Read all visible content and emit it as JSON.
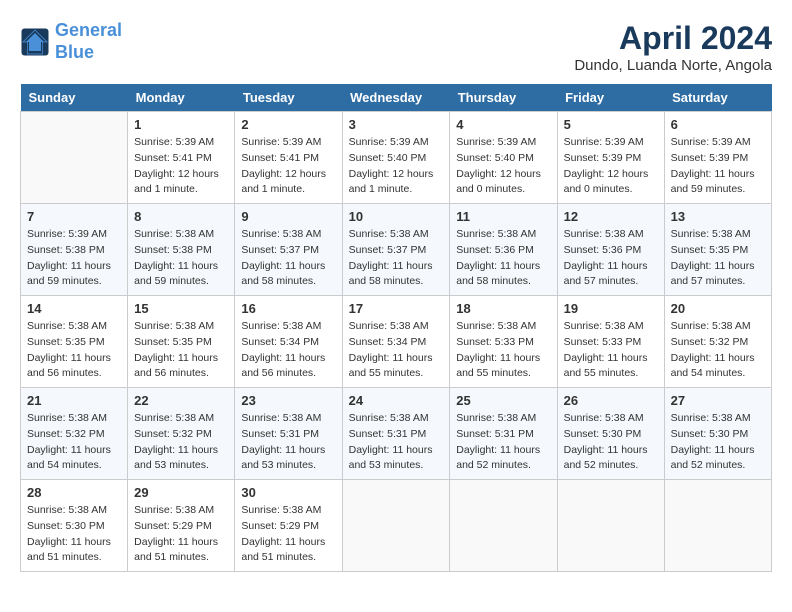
{
  "header": {
    "logo_line1": "General",
    "logo_line2": "Blue",
    "month_year": "April 2024",
    "location": "Dundo, Luanda Norte, Angola"
  },
  "days_of_week": [
    "Sunday",
    "Monday",
    "Tuesday",
    "Wednesday",
    "Thursday",
    "Friday",
    "Saturday"
  ],
  "weeks": [
    [
      {
        "num": "",
        "info": ""
      },
      {
        "num": "1",
        "info": "Sunrise: 5:39 AM\nSunset: 5:41 PM\nDaylight: 12 hours\nand 1 minute."
      },
      {
        "num": "2",
        "info": "Sunrise: 5:39 AM\nSunset: 5:41 PM\nDaylight: 12 hours\nand 1 minute."
      },
      {
        "num": "3",
        "info": "Sunrise: 5:39 AM\nSunset: 5:40 PM\nDaylight: 12 hours\nand 1 minute."
      },
      {
        "num": "4",
        "info": "Sunrise: 5:39 AM\nSunset: 5:40 PM\nDaylight: 12 hours\nand 0 minutes."
      },
      {
        "num": "5",
        "info": "Sunrise: 5:39 AM\nSunset: 5:39 PM\nDaylight: 12 hours\nand 0 minutes."
      },
      {
        "num": "6",
        "info": "Sunrise: 5:39 AM\nSunset: 5:39 PM\nDaylight: 11 hours\nand 59 minutes."
      }
    ],
    [
      {
        "num": "7",
        "info": "Sunrise: 5:39 AM\nSunset: 5:38 PM\nDaylight: 11 hours\nand 59 minutes."
      },
      {
        "num": "8",
        "info": "Sunrise: 5:38 AM\nSunset: 5:38 PM\nDaylight: 11 hours\nand 59 minutes."
      },
      {
        "num": "9",
        "info": "Sunrise: 5:38 AM\nSunset: 5:37 PM\nDaylight: 11 hours\nand 58 minutes."
      },
      {
        "num": "10",
        "info": "Sunrise: 5:38 AM\nSunset: 5:37 PM\nDaylight: 11 hours\nand 58 minutes."
      },
      {
        "num": "11",
        "info": "Sunrise: 5:38 AM\nSunset: 5:36 PM\nDaylight: 11 hours\nand 58 minutes."
      },
      {
        "num": "12",
        "info": "Sunrise: 5:38 AM\nSunset: 5:36 PM\nDaylight: 11 hours\nand 57 minutes."
      },
      {
        "num": "13",
        "info": "Sunrise: 5:38 AM\nSunset: 5:35 PM\nDaylight: 11 hours\nand 57 minutes."
      }
    ],
    [
      {
        "num": "14",
        "info": "Sunrise: 5:38 AM\nSunset: 5:35 PM\nDaylight: 11 hours\nand 56 minutes."
      },
      {
        "num": "15",
        "info": "Sunrise: 5:38 AM\nSunset: 5:35 PM\nDaylight: 11 hours\nand 56 minutes."
      },
      {
        "num": "16",
        "info": "Sunrise: 5:38 AM\nSunset: 5:34 PM\nDaylight: 11 hours\nand 56 minutes."
      },
      {
        "num": "17",
        "info": "Sunrise: 5:38 AM\nSunset: 5:34 PM\nDaylight: 11 hours\nand 55 minutes."
      },
      {
        "num": "18",
        "info": "Sunrise: 5:38 AM\nSunset: 5:33 PM\nDaylight: 11 hours\nand 55 minutes."
      },
      {
        "num": "19",
        "info": "Sunrise: 5:38 AM\nSunset: 5:33 PM\nDaylight: 11 hours\nand 55 minutes."
      },
      {
        "num": "20",
        "info": "Sunrise: 5:38 AM\nSunset: 5:32 PM\nDaylight: 11 hours\nand 54 minutes."
      }
    ],
    [
      {
        "num": "21",
        "info": "Sunrise: 5:38 AM\nSunset: 5:32 PM\nDaylight: 11 hours\nand 54 minutes."
      },
      {
        "num": "22",
        "info": "Sunrise: 5:38 AM\nSunset: 5:32 PM\nDaylight: 11 hours\nand 53 minutes."
      },
      {
        "num": "23",
        "info": "Sunrise: 5:38 AM\nSunset: 5:31 PM\nDaylight: 11 hours\nand 53 minutes."
      },
      {
        "num": "24",
        "info": "Sunrise: 5:38 AM\nSunset: 5:31 PM\nDaylight: 11 hours\nand 53 minutes."
      },
      {
        "num": "25",
        "info": "Sunrise: 5:38 AM\nSunset: 5:31 PM\nDaylight: 11 hours\nand 52 minutes."
      },
      {
        "num": "26",
        "info": "Sunrise: 5:38 AM\nSunset: 5:30 PM\nDaylight: 11 hours\nand 52 minutes."
      },
      {
        "num": "27",
        "info": "Sunrise: 5:38 AM\nSunset: 5:30 PM\nDaylight: 11 hours\nand 52 minutes."
      }
    ],
    [
      {
        "num": "28",
        "info": "Sunrise: 5:38 AM\nSunset: 5:30 PM\nDaylight: 11 hours\nand 51 minutes."
      },
      {
        "num": "29",
        "info": "Sunrise: 5:38 AM\nSunset: 5:29 PM\nDaylight: 11 hours\nand 51 minutes."
      },
      {
        "num": "30",
        "info": "Sunrise: 5:38 AM\nSunset: 5:29 PM\nDaylight: 11 hours\nand 51 minutes."
      },
      {
        "num": "",
        "info": ""
      },
      {
        "num": "",
        "info": ""
      },
      {
        "num": "",
        "info": ""
      },
      {
        "num": "",
        "info": ""
      }
    ]
  ]
}
